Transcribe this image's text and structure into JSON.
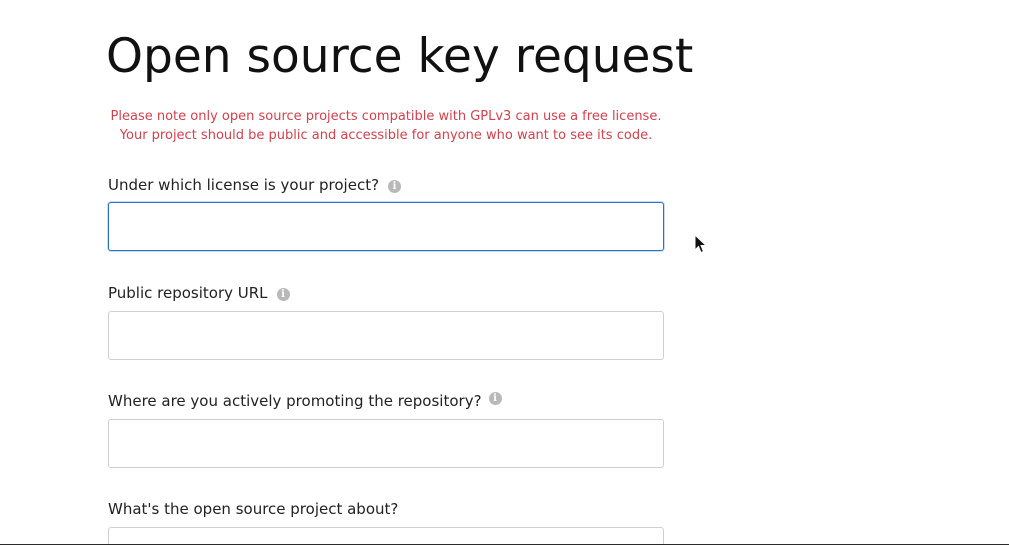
{
  "page": {
    "title": "Open source key request",
    "notice_line1": "Please note only open source projects compatible with GPLv3 can use a free license.",
    "notice_line2": "Your project should be public and accessible for anyone who want to see its code."
  },
  "form": {
    "license": {
      "label": "Under which license is your project?",
      "value": "",
      "info_icon": "info-icon"
    },
    "repo_url": {
      "label": "Public repository URL",
      "value": "",
      "info_icon": "info-icon"
    },
    "promotion": {
      "label": "Where are you actively promoting the repository?",
      "value": "",
      "info_icon": "info-icon"
    },
    "about": {
      "label": "What's the open source project about?",
      "value": ""
    }
  },
  "colors": {
    "notice": "#d2414d",
    "focus_border": "#2a72c2",
    "input_border": "#cfcfcf",
    "info_icon": "#b9b9b9"
  }
}
